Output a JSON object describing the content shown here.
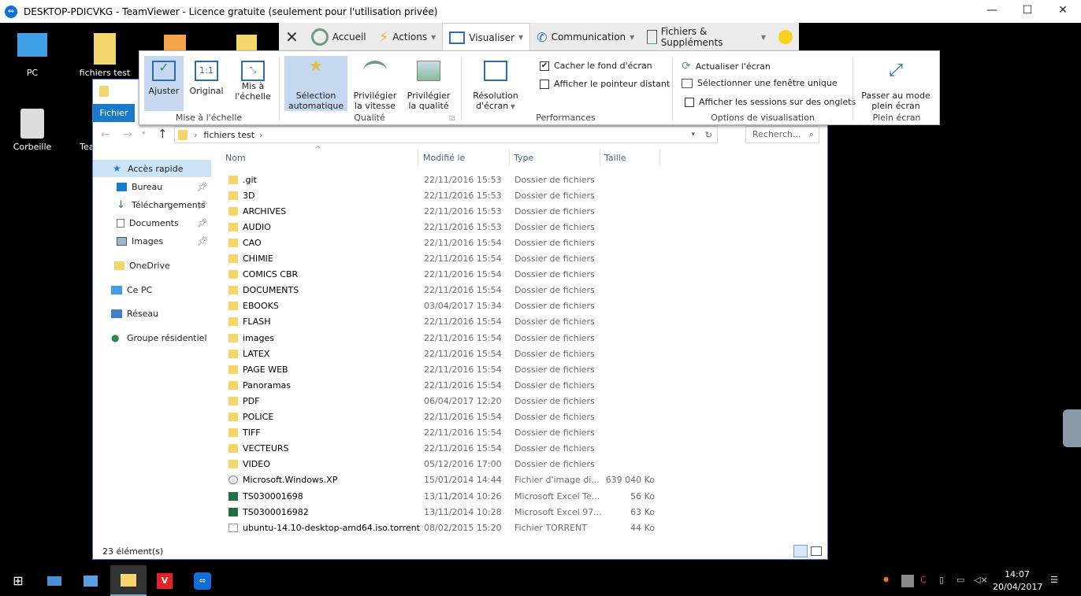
{
  "window": {
    "title": "DESKTOP-PDICVKG - TeamViewer - Licence gratuite (seulement pour l'utilisation privée)"
  },
  "desktop": {
    "icons": [
      {
        "label": "PC"
      },
      {
        "label": "fichiers test"
      },
      {
        "label": "Corbeille"
      },
      {
        "label": "Tear"
      }
    ]
  },
  "toolbar": {
    "items": [
      {
        "label": "Accueil"
      },
      {
        "label": "Actions"
      },
      {
        "label": "Visualiser"
      },
      {
        "label": "Communication"
      },
      {
        "label": "Fichiers & Suppléments"
      }
    ]
  },
  "ribbon": {
    "scaling": {
      "group": "Mise à l'échelle",
      "ajuster": "Ajuster",
      "original": "Original",
      "mis_echelle": "Mis à l'échelle"
    },
    "quality": {
      "group": "Qualité",
      "auto": "Sélection automatique",
      "speed": "Privilégier la vitesse",
      "quality": "Privilégier la qualité"
    },
    "performance": {
      "group": "Performances",
      "resolution": "Résolution d'écran",
      "hide_wallpaper": "Cacher le fond d'écran",
      "hide_wallpaper_checked": true,
      "show_pointer": "Afficher le pointeur distant",
      "show_pointer_checked": false
    },
    "view_options": {
      "group": "Options de visualisation",
      "refresh": "Actualiser l'écran",
      "select_window": "Sélectionner une fenêtre unique",
      "tabs": "Afficher les sessions sur des onglets",
      "tabs_checked": false
    },
    "fullscreen": {
      "group": "Plein écran",
      "label": "Passer au mode plein écran"
    }
  },
  "explorer": {
    "file_tab": "Fichier",
    "breadcrumb": "fichiers test",
    "search_placeholder": "Recherch...",
    "nav": [
      {
        "label": "Accès rapide"
      },
      {
        "label": "Bureau"
      },
      {
        "label": "Téléchargements"
      },
      {
        "label": "Documents"
      },
      {
        "label": "Images"
      },
      {
        "label": "OneDrive"
      },
      {
        "label": "Ce PC"
      },
      {
        "label": "Réseau"
      },
      {
        "label": "Groupe résidentiel"
      }
    ],
    "columns": [
      "Nom",
      "Modifié le",
      "Type",
      "Taille"
    ],
    "files": [
      {
        "name": ".git",
        "date": "22/11/2016 15:53",
        "type": "Dossier de fichiers",
        "size": "",
        "icon": "folder"
      },
      {
        "name": "3D",
        "date": "22/11/2016 15:53",
        "type": "Dossier de fichiers",
        "size": "",
        "icon": "folder"
      },
      {
        "name": "ARCHIVES",
        "date": "22/11/2016 15:53",
        "type": "Dossier de fichiers",
        "size": "",
        "icon": "folder"
      },
      {
        "name": "AUDIO",
        "date": "22/11/2016 15:53",
        "type": "Dossier de fichiers",
        "size": "",
        "icon": "folder"
      },
      {
        "name": "CAO",
        "date": "22/11/2016 15:54",
        "type": "Dossier de fichiers",
        "size": "",
        "icon": "folder"
      },
      {
        "name": "CHIMIE",
        "date": "22/11/2016 15:54",
        "type": "Dossier de fichiers",
        "size": "",
        "icon": "folder"
      },
      {
        "name": "COMICS CBR",
        "date": "22/11/2016 15:54",
        "type": "Dossier de fichiers",
        "size": "",
        "icon": "folder"
      },
      {
        "name": "DOCUMENTS",
        "date": "22/11/2016 15:54",
        "type": "Dossier de fichiers",
        "size": "",
        "icon": "folder"
      },
      {
        "name": "EBOOKS",
        "date": "03/04/2017 15:34",
        "type": "Dossier de fichiers",
        "size": "",
        "icon": "folder"
      },
      {
        "name": "FLASH",
        "date": "22/11/2016 15:54",
        "type": "Dossier de fichiers",
        "size": "",
        "icon": "folder"
      },
      {
        "name": "images",
        "date": "22/11/2016 15:54",
        "type": "Dossier de fichiers",
        "size": "",
        "icon": "folder"
      },
      {
        "name": "LATEX",
        "date": "22/11/2016 15:54",
        "type": "Dossier de fichiers",
        "size": "",
        "icon": "folder"
      },
      {
        "name": "PAGE WEB",
        "date": "22/11/2016 15:54",
        "type": "Dossier de fichiers",
        "size": "",
        "icon": "folder"
      },
      {
        "name": "Panoramas",
        "date": "22/11/2016 15:54",
        "type": "Dossier de fichiers",
        "size": "",
        "icon": "folder"
      },
      {
        "name": "PDF",
        "date": "06/04/2017 12:20",
        "type": "Dossier de fichiers",
        "size": "",
        "icon": "folder"
      },
      {
        "name": "POLICE",
        "date": "22/11/2016 15:54",
        "type": "Dossier de fichiers",
        "size": "",
        "icon": "folder"
      },
      {
        "name": "TIFF",
        "date": "22/11/2016 15:54",
        "type": "Dossier de fichiers",
        "size": "",
        "icon": "folder"
      },
      {
        "name": "VECTEURS",
        "date": "22/11/2016 15:54",
        "type": "Dossier de fichiers",
        "size": "",
        "icon": "folder"
      },
      {
        "name": "VIDEO",
        "date": "05/12/2016 17:00",
        "type": "Dossier de fichiers",
        "size": "",
        "icon": "folder"
      },
      {
        "name": "Microsoft.Windows.XP",
        "date": "15/01/2014 14:44",
        "type": "Fichier d'image di...",
        "size": "639 040 Ko",
        "icon": "disc"
      },
      {
        "name": "TS030001698",
        "date": "13/11/2014 10:26",
        "type": "Microsoft Excel Te...",
        "size": "56 Ko",
        "icon": "excel"
      },
      {
        "name": "TS0300016982",
        "date": "13/11/2014 10:28",
        "type": "Microsoft Excel 97...",
        "size": "63 Ko",
        "icon": "excel"
      },
      {
        "name": "ubuntu-14.10-desktop-amd64.iso.torrent",
        "date": "08/02/2015 15:20",
        "type": "Fichier TORRENT",
        "size": "44 Ko",
        "icon": "file"
      }
    ],
    "status": "23 élément(s)"
  },
  "taskbar": {
    "time": "14:07",
    "date": "20/04/2017"
  }
}
